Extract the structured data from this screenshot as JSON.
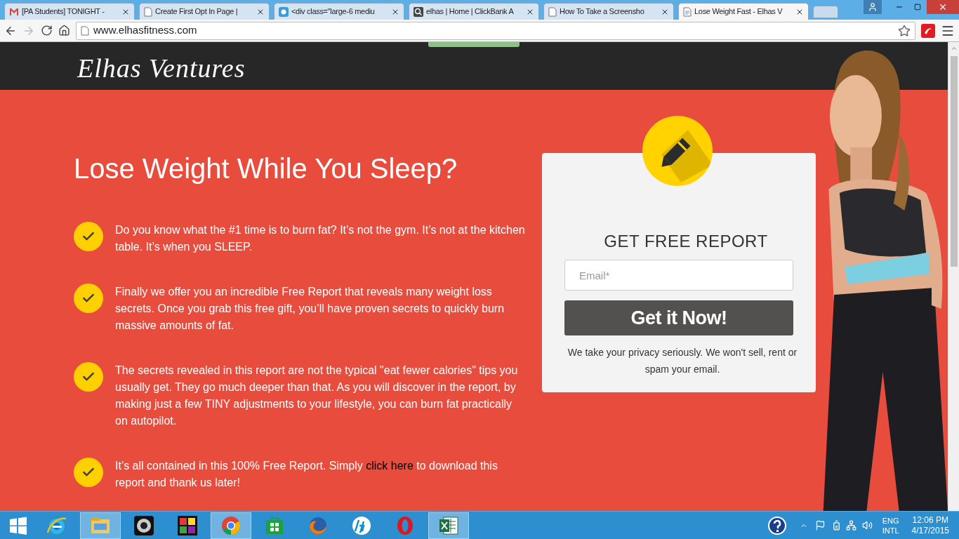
{
  "browser": {
    "tabs": [
      {
        "title": "[PA Students] TONIGHT -",
        "kind": "mail",
        "selected": false
      },
      {
        "title": "Create First Opt In Page |",
        "kind": "page",
        "selected": false
      },
      {
        "title": "<div class=\"large-6 mediu",
        "kind": "bird",
        "selected": false
      },
      {
        "title": "elhas | Home | ClickBank A",
        "kind": "search",
        "selected": false
      },
      {
        "title": "How To Take a Screensho",
        "kind": "page",
        "selected": false
      },
      {
        "title": "Lose Weight Fast - Elhas V",
        "kind": "doc",
        "selected": true
      }
    ],
    "address": "www.elhasfitness.com"
  },
  "page": {
    "brand": "Elhas Ventures",
    "headline": "Lose Weight While You Sleep?",
    "bullets": [
      {
        "text": "Do you know what the #1 time is to burn fat? It’s not the gym. It’s not at the kitchen table. It’s when you SLEEP."
      },
      {
        "text": "Finally we offer you an incredible Free Report that reveals many weight loss secrets. Once you grab this free gift, you’ll have proven secrets to quickly burn massive amounts of fat."
      },
      {
        "text": "The secrets revealed in this report are not the typical \"eat fewer calories\" tips you usually get. They go much deeper than that. As you will discover in the report, by making just a few TINY adjustments to your lifestyle, you can burn fat practically on autopilot."
      },
      {
        "text": "It’s all contained in this 100% Free Report. Simply",
        "link": "click here",
        "text_after": "to download this report and thank us later!"
      }
    ],
    "form": {
      "title": "GET FREE REPORT",
      "placeholder": "Email*",
      "button": "Get it Now!",
      "privacy": "We take your privacy seriously. We won't sell, rent or spam your email."
    }
  },
  "taskbar": {
    "apps": [
      {
        "kind": "ie",
        "active": false
      },
      {
        "kind": "explorer",
        "active": true
      },
      {
        "kind": "camera",
        "active": false
      },
      {
        "kind": "puzzle",
        "active": false
      },
      {
        "kind": "chrome",
        "active": true
      },
      {
        "kind": "store",
        "active": false
      },
      {
        "kind": "firefox",
        "active": false
      },
      {
        "kind": "hp",
        "active": false
      },
      {
        "kind": "opera",
        "active": false
      },
      {
        "kind": "excel",
        "active": true
      }
    ],
    "tray": {
      "language": "ENG",
      "layout": "INTL",
      "time": "12:06 PM",
      "date": "4/17/2015"
    }
  }
}
